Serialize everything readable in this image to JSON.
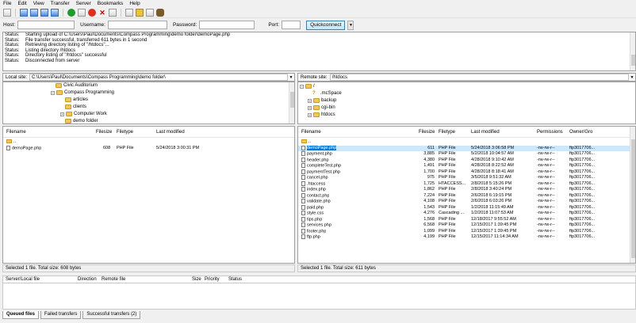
{
  "menu": [
    "File",
    "Edit",
    "View",
    "Transfer",
    "Server",
    "Bookmarks",
    "Help"
  ],
  "quickconnect": {
    "host_label": "Host:",
    "username_label": "Username:",
    "password_label": "Password:",
    "port_label": "Port:",
    "button": "Quickconnect",
    "host": "",
    "username": "",
    "password": "",
    "port": ""
  },
  "log": [
    {
      "label": "Status:",
      "text": "Starting upload of C:\\Users\\Paul\\Documents\\Compass Programming\\demo folder\\demoPage.php"
    },
    {
      "label": "Status:",
      "text": "File transfer successful, transferred 611 bytes in 1 second"
    },
    {
      "label": "Status:",
      "text": "Retrieving directory listing of \"/htdocs\"..."
    },
    {
      "label": "Status:",
      "text": "Listing directory /htdocs"
    },
    {
      "label": "Status:",
      "text": "Directory listing of \"/htdocs\" successful"
    },
    {
      "label": "Status:",
      "text": "Disconnected from server"
    }
  ],
  "local": {
    "label": "Local site:",
    "path": "C:\\Users\\Paul\\Documents\\Compass Programming\\demo folder\\",
    "tree": [
      "Civic Auditorium",
      "Compass Programming",
      "articles",
      "clients",
      "Computer Work",
      "demo folder"
    ],
    "headers": {
      "name": "Filename",
      "size": "Filesize",
      "type": "Filetype",
      "modified": "Last modified"
    },
    "files": [
      {
        "name": "..",
        "size": "",
        "type": "",
        "modified": ""
      },
      {
        "name": "demoPage.php",
        "size": "608",
        "type": "PHP File",
        "modified": "5/24/2018 3:00:31 PM"
      }
    ],
    "status": "Selected 1 file. Total size: 608 bytes"
  },
  "remote": {
    "label": "Remote site:",
    "path": "/htdocs",
    "tree": [
      "/",
      ".mcSpace",
      "backup",
      "cgi-bin",
      "htdocs"
    ],
    "headers": {
      "name": "Filename",
      "size": "Filesize",
      "type": "Filetype",
      "modified": "Last modified",
      "perms": "Permissions",
      "owner": "Owner/Gro"
    },
    "files": [
      {
        "name": "..",
        "size": "",
        "type": "",
        "modified": "",
        "perms": "",
        "owner": ""
      },
      {
        "name": "demoPage.php",
        "size": "611",
        "type": "PHP File",
        "modified": "5/24/2018 3:06:58 PM",
        "perms": "-rw-rw-r--",
        "owner": "ftp3017706..."
      },
      {
        "name": "payment.php",
        "size": "3,885",
        "type": "PHP File",
        "modified": "5/2/2018 10:04:57 AM",
        "perms": "-rw-rw-r--",
        "owner": "ftp3017706..."
      },
      {
        "name": "header.php",
        "size": "4,380",
        "type": "PHP File",
        "modified": "4/28/2018 9:10:42 AM",
        "perms": "-rw-rw-r--",
        "owner": "ftp3017706..."
      },
      {
        "name": "completeTest.php",
        "size": "1,491",
        "type": "PHP File",
        "modified": "4/28/2018 8:22:52 AM",
        "perms": "-rw-rw-r--",
        "owner": "ftp3017706..."
      },
      {
        "name": "paymentTest.php",
        "size": "1,700",
        "type": "PHP File",
        "modified": "4/28/2018 8:18:41 AM",
        "perms": "-rw-rw-r--",
        "owner": "ftp3017706..."
      },
      {
        "name": "cancel.php",
        "size": "975",
        "type": "PHP File",
        "modified": "3/5/2018 9:51:32 AM",
        "perms": "-rw-rw-r--",
        "owner": "ftp3017706..."
      },
      {
        "name": ".htaccess",
        "size": "1,725",
        "type": "HTACCESS...",
        "modified": "2/8/2018 5:15:26 PM",
        "perms": "-rw-rw-r--",
        "owner": "ftp3017706..."
      },
      {
        "name": "index.php",
        "size": "1,862",
        "type": "PHP File",
        "modified": "2/8/2018 3:40:24 PM",
        "perms": "-rw-rw-r--",
        "owner": "ftp3017706..."
      },
      {
        "name": "contact.php",
        "size": "7,224",
        "type": "PHP File",
        "modified": "2/6/2018 6:19:15 PM",
        "perms": "-rw-rw-r--",
        "owner": "ftp3017706..."
      },
      {
        "name": "validate.php",
        "size": "4,108",
        "type": "PHP File",
        "modified": "2/6/2018 6:03:26 PM",
        "perms": "-rw-rw-r--",
        "owner": "ftp3017706..."
      },
      {
        "name": "paid.php",
        "size": "1,543",
        "type": "PHP File",
        "modified": "1/2/2018 11:15:49 AM",
        "perms": "-rw-rw-r--",
        "owner": "ftp3017706..."
      },
      {
        "name": "style.css",
        "size": "4,276",
        "type": "Cascading ...",
        "modified": "1/2/2018 11:07:53 AM",
        "perms": "-rw-rw-r--",
        "owner": "ftp3017706..."
      },
      {
        "name": "tips.php",
        "size": "1,568",
        "type": "PHP File",
        "modified": "12/18/2017 9:55:52 AM",
        "perms": "-rw-rw-r--",
        "owner": "ftp3017706..."
      },
      {
        "name": "services.php",
        "size": "6,568",
        "type": "PHP File",
        "modified": "12/15/2017 1:39:45 PM",
        "perms": "-rw-rw-r--",
        "owner": "ftp3017706..."
      },
      {
        "name": "footer.php",
        "size": "1,099",
        "type": "PHP File",
        "modified": "12/15/2017 1:39:45 PM",
        "perms": "-rw-rw-r--",
        "owner": "ftp3017706..."
      },
      {
        "name": "ftp.php",
        "size": "4,199",
        "type": "PHP File",
        "modified": "12/15/2017 11:14:34 AM",
        "perms": "-rw-rw-r--",
        "owner": "ftp3017706..."
      }
    ],
    "status": "Selected 1 file. Total size: 611 bytes"
  },
  "queue": {
    "headers": {
      "server": "Server/Local file",
      "direction": "Direction",
      "remote": "Remote file",
      "size": "Size",
      "priority": "Priority",
      "status": "Status"
    },
    "tabs": [
      "Queued files",
      "Failed transfers",
      "Successful transfers (2)"
    ]
  },
  "colors": {
    "selection": "#0078d7",
    "folder": "#f1c75b"
  }
}
